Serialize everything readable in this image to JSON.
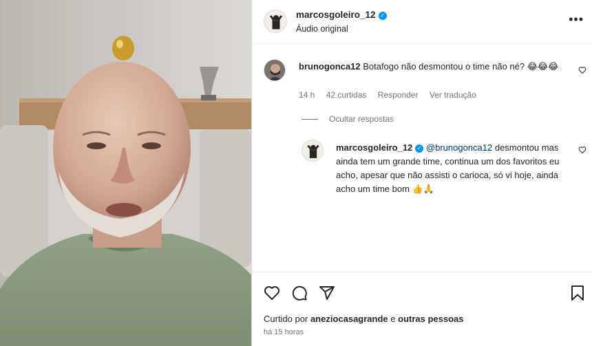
{
  "post": {
    "author": "marcosgoleiro_12",
    "audio_label": "Áudio original",
    "more_icon": "more-horizontal-icon"
  },
  "comment": {
    "username": "brunogonca12",
    "text": "Botafogo não desmontou o time não né? 😂😂😂",
    "time": "14 h",
    "likes": "42 curtidas",
    "reply_label": "Responder",
    "translate_label": "Ver tradução"
  },
  "replies_toggle": "Ocultar respostas",
  "reply": {
    "username": "marcosgoleiro_12",
    "mention": "@brunogonca12",
    "text": " desmontou mas ainda tem um grande time, continua um dos favoritos eu acho, apesar que não assisti o carioca, só vi hoje, ainda acho um time bom 👍🙏"
  },
  "footer": {
    "liked_prefix": "Curtido por",
    "liked_user": "aneziocasagrande",
    "liked_connector": "e",
    "liked_others": "outras pessoas",
    "posted_time": "há 15 horas"
  },
  "icons": [
    "heart-icon",
    "comment-icon",
    "share-icon",
    "bookmark-icon",
    "verified-icon"
  ],
  "colors": {
    "accent": "#0095f6",
    "text": "#262626",
    "muted": "#737373",
    "mention": "#00376b"
  }
}
